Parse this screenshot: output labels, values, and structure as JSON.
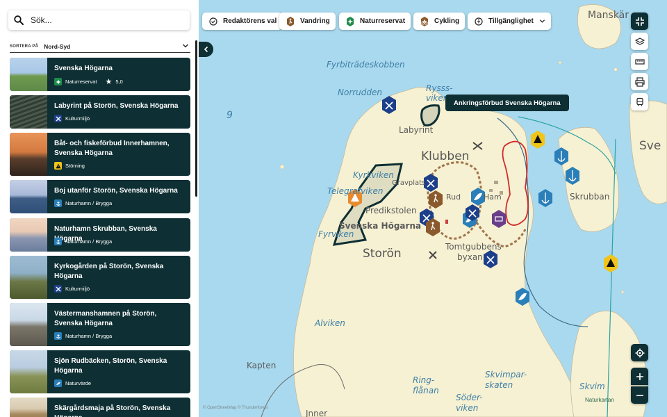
{
  "search": {
    "placeholder": "Sök..."
  },
  "sort": {
    "label": "SORTERA PÅ",
    "value": "Nord-Syd"
  },
  "cards": [
    {
      "title": "Svenska Högarna",
      "category": "Naturreservat",
      "rating": "5,0",
      "icon": "reserve-icon",
      "icon_color": "#1e8a4c",
      "thumb": [
        "#a9c8e8",
        "#5e8a4a"
      ]
    },
    {
      "title": "Labyrint på Storön, Svenska Högarna",
      "category": "Kulturmiljö",
      "icon": "culture-icon",
      "icon_color": "#1d3f8a",
      "thumb": [
        "#3a4a3e",
        "#6b7a64"
      ]
    },
    {
      "title": "Båt- och fiskeförbud Innerhamnen, Svenska Högarna",
      "category": "Störning",
      "icon": "warning-icon",
      "icon_color": "#f0c419",
      "thumb": [
        "#e6864a",
        "#3d2e24"
      ]
    },
    {
      "title": "Boj utanför Storön, Svenska Högarna",
      "category": "Naturhamn / Brygga",
      "icon": "anchor-icon",
      "icon_color": "#2b7fb8",
      "thumb": [
        "#a7b9d8",
        "#2f4f78"
      ]
    },
    {
      "title": "Naturhamn Skrubban, Svenska Högarna",
      "category": "Naturhamn / Brygga",
      "icon": "anchor-icon",
      "icon_color": "#2b7fb8",
      "thumb": [
        "#e8c9b4",
        "#6a7d9c"
      ]
    },
    {
      "title": "Kyrkogården på Storön, Svenska Högarna",
      "category": "Kulturmiljö",
      "icon": "culture-icon",
      "icon_color": "#1d3f8a",
      "thumb": [
        "#8eb0c7",
        "#5d6b3a"
      ]
    },
    {
      "title": "Västermanshamnen på Storön, Svenska Högarna",
      "category": "Naturhamn / Brygga",
      "icon": "anchor-icon",
      "icon_color": "#2b7fb8",
      "thumb": [
        "#c9d8e6",
        "#6e6a5e"
      ]
    },
    {
      "title": "Sjön Rudbäcken, Storön, Svenska Högarna",
      "category": "Naturvärde",
      "icon": "nature-icon",
      "icon_color": "#2b7fb8",
      "thumb": [
        "#b9cde0",
        "#7a8a4e"
      ]
    },
    {
      "title": "Skärgårdsmaja på Storön, Svenska Högarna",
      "category": "",
      "icon": "",
      "icon_color": "#2b7fb8",
      "thumb": [
        "#d8cbb0",
        "#9a7b50"
      ]
    }
  ],
  "filters": [
    {
      "label": "Redaktörens val",
      "icon": "check-circle-icon"
    },
    {
      "label": "Vandring",
      "icon": "hiking-icon"
    },
    {
      "label": "Naturreservat",
      "icon": "reserve-icon"
    },
    {
      "label": "Cykling",
      "icon": "cycling-icon"
    },
    {
      "label": "Tillgänglighet",
      "icon": "accessibility-icon"
    }
  ],
  "tooltip": "Ankringsförbud Svenska Högarna",
  "places": {
    "manskar": "Manskär",
    "fyrbitradeskobben": "Fyrbiträdeskobben",
    "norrudden": "Norrudden",
    "ryssviken": "Rysss-viken",
    "labyrint": "Labyrint",
    "klubben": "Klubben",
    "sve": "Sve",
    "kyrkviken": "Kyrkviken",
    "telegrafviken": "Telegrafviken",
    "gravplats": "Gravplats",
    "predikstolen": "Predikstolen",
    "svenska_hogarna": "Svenska Högarna",
    "fyrviken": "Fyrviken",
    "storon": "Storön",
    "tomtgubbens": "Tomtgubbens",
    "byxan": "byxan",
    "skrubban": "Skrubban",
    "alviken": "Alviken",
    "kapten": "Kapten",
    "ringflanan": "Ring-flånan",
    "soderviken": "Söder-viken",
    "skvimpar": "Skvimpar-skaten",
    "skvim": "Skvim",
    "jnner": "Jnner",
    "number_9": "9",
    "rudb": "Rud",
    "ham": "Ham"
  },
  "attribution": "© OpenStreetMap © Thunderforest",
  "mapservice": "Naturkartan"
}
